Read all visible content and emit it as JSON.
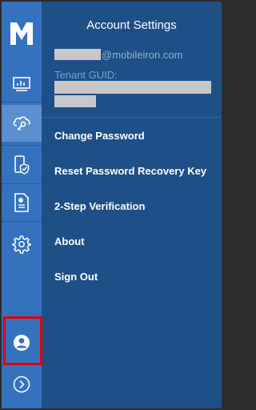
{
  "header": {
    "title": "Account Settings",
    "email_domain": "@mobileiron.com",
    "tenant_label": "Tenant GUID:"
  },
  "menu": {
    "items": [
      {
        "label": "Change Password"
      },
      {
        "label": "Reset Password Recovery Key"
      },
      {
        "label": "2-Step Verification"
      },
      {
        "label": "About"
      },
      {
        "label": "Sign Out"
      }
    ]
  },
  "sidebar": {
    "icons": [
      "dashboard-icon",
      "cloud-key-icon",
      "device-shield-icon",
      "document-icon",
      "gear-icon",
      "user-icon",
      "chevron-right-icon"
    ],
    "active": "cloud-key-icon",
    "highlighted": "user-icon"
  },
  "colors": {
    "rail": "#3572bd",
    "panel": "#1e4f87",
    "active_item": "#5b8fcf",
    "highlight_border": "#e00000",
    "text": "#ffffff",
    "muted_text": "#8fb0d6"
  }
}
